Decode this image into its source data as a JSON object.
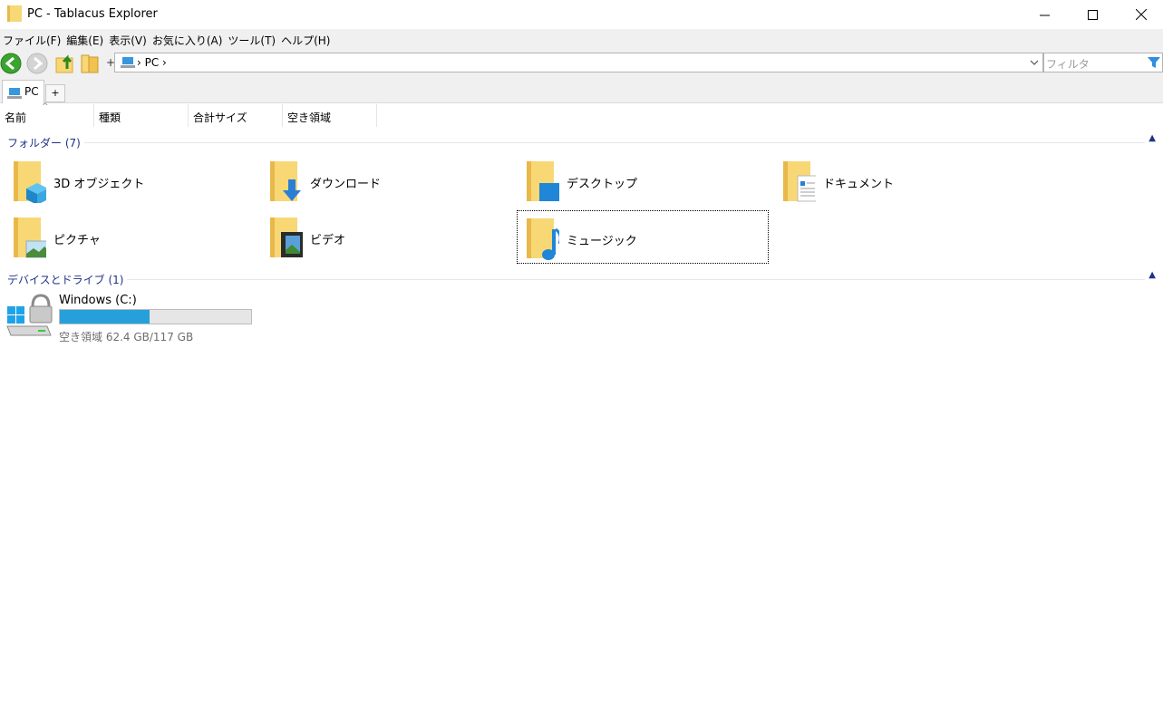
{
  "window": {
    "title": "PC - Tablacus Explorer",
    "minimize_glyph": "—",
    "maximize_glyph": "☐",
    "close_glyph": "✕"
  },
  "menu": [
    {
      "label": "ファイル(F)"
    },
    {
      "label": "編集(E)"
    },
    {
      "label": "表示(V)"
    },
    {
      "label": "お気に入り(A)"
    },
    {
      "label": "ツール(T)"
    },
    {
      "label": "ヘルプ(H)"
    }
  ],
  "toolbar": {
    "add_glyph": "+",
    "address": "› PC ›",
    "filter_placeholder": "フィルタ"
  },
  "tabs": {
    "active_label": "PC",
    "add_glyph": "+"
  },
  "columns": {
    "name": "名前",
    "type": "種類",
    "total": "合計サイズ",
    "free": "空き領域",
    "sort_glyph": "^"
  },
  "groups": {
    "folders": {
      "label": "フォルダー (7)",
      "collapse_glyph": "▲"
    },
    "devices": {
      "label": "デバイスとドライブ (1)",
      "collapse_glyph": "▲"
    }
  },
  "folders": [
    {
      "label": "3D オブジェクト",
      "icon": "3d-objects-icon"
    },
    {
      "label": "ダウンロード",
      "icon": "downloads-icon"
    },
    {
      "label": "デスクトップ",
      "icon": "desktop-icon"
    },
    {
      "label": "ドキュメント",
      "icon": "documents-icon"
    },
    {
      "label": "ピクチャ",
      "icon": "pictures-icon"
    },
    {
      "label": "ビデオ",
      "icon": "videos-icon"
    },
    {
      "label": "ミュージック",
      "icon": "music-icon"
    }
  ],
  "drive": {
    "label": "Windows (C:)",
    "free_text": "空き領域 62.4 GB/117 GB",
    "used_fraction": 0.467,
    "icon": "windows-drive-icon"
  },
  "colors": {
    "accent": "#26a0da",
    "group_text": "#1e3287",
    "folder_yellow": "#f8d775"
  }
}
